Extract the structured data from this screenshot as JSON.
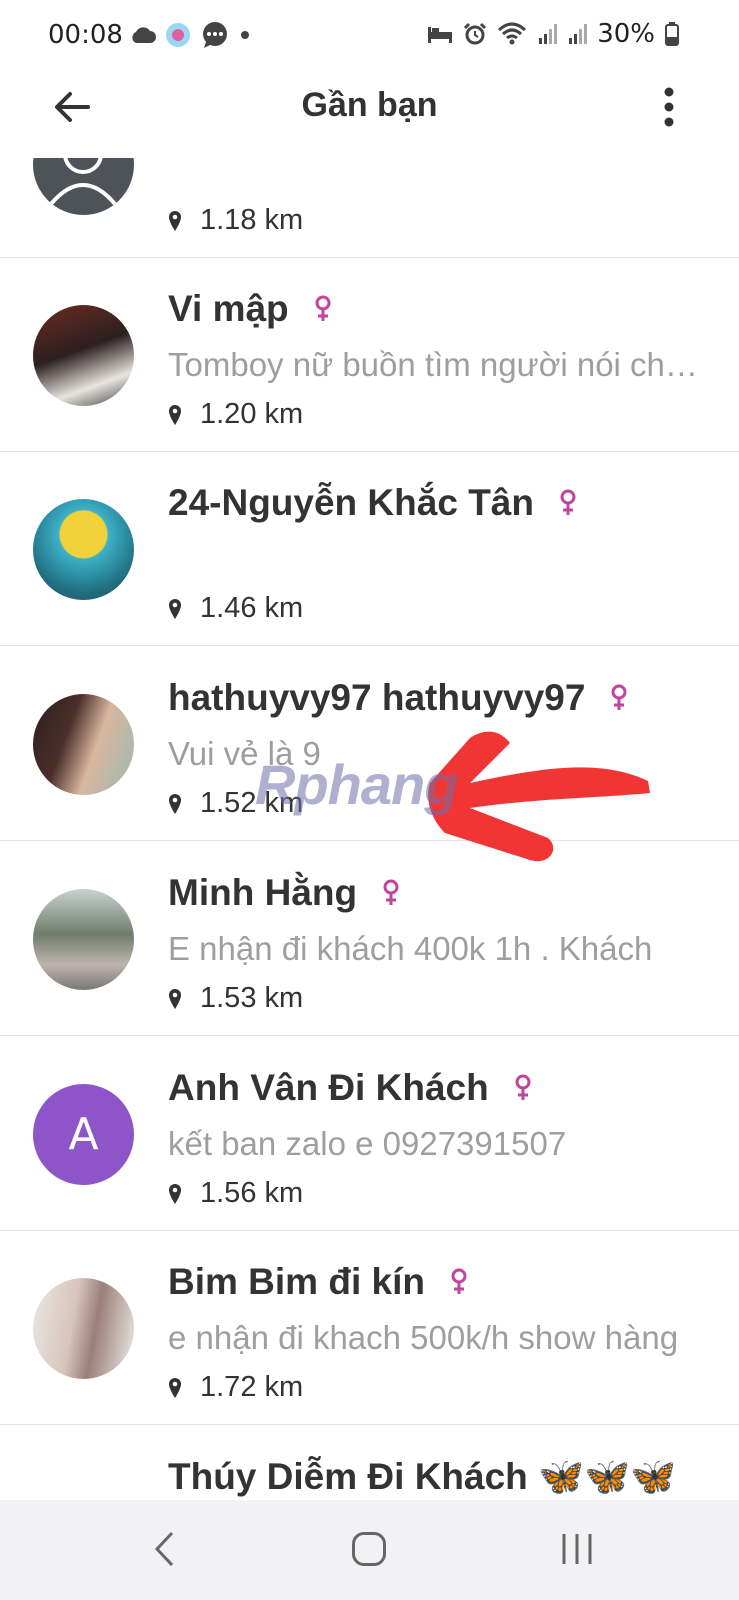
{
  "status_bar": {
    "time": "00:08",
    "battery": "30%",
    "left_icons": [
      "cloud-icon",
      "app-notification-icon",
      "chat-bubble-icon",
      "dot-icon"
    ],
    "right_icons": [
      "bed-icon",
      "alarm-icon",
      "wifi-icon",
      "signal-icon",
      "signal-icon",
      "battery-icon"
    ]
  },
  "app_bar": {
    "title": "Gần bạn"
  },
  "items": [
    {
      "name": "",
      "bio": "",
      "distance": "1.18 km",
      "avatar": "default-person"
    },
    {
      "name": "Vi mập",
      "bio": "Tomboy nữ buồn tìm người nói chuyện",
      "distance": "1.20 km",
      "avatar": "photo"
    },
    {
      "name": "24-Nguyễn Khắc Tân",
      "bio": "",
      "distance": "1.46 km",
      "avatar": "photo"
    },
    {
      "name": "hathuyvy97 hathuyvy97",
      "bio": "Vui vẻ là 9",
      "distance": "1.52 km",
      "avatar": "photo"
    },
    {
      "name": "Minh Hằng",
      "bio": "E nhận đi khách 400k 1h . Khách",
      "distance": "1.53 km",
      "avatar": "photo"
    },
    {
      "name": "Anh Vân Đi Khách",
      "bio": "kết ban zalo e 0927391507",
      "distance": "1.56 km",
      "avatar": "letter",
      "letter": "A"
    },
    {
      "name": "Bim Bim đi kín",
      "bio": "e nhận đi khach 500k/h show hàng",
      "distance": "1.72 km",
      "avatar": "photo"
    },
    {
      "name": "Thúy Diễm Đi Khách 🦋🦋🦋",
      "bio": "",
      "distance": "",
      "avatar": "photo"
    }
  ],
  "watermark": "Rphang",
  "colors": {
    "female_icon": "#c2459b",
    "letter_avatar": "#8e55c9",
    "annotation_arrow": "#f02a2a"
  },
  "nav_bar": {
    "buttons": [
      "back-icon",
      "home-icon",
      "recent-apps-icon"
    ]
  }
}
